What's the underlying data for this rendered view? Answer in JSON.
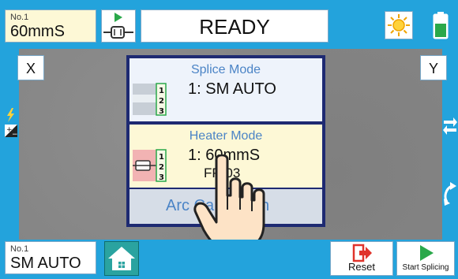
{
  "top": {
    "heater_program_small": "No.1",
    "heater_program_name": "60mmS",
    "status": "READY"
  },
  "camera": {
    "x_label": "X",
    "y_label": "Y"
  },
  "menu": {
    "splice": {
      "title": "Splice Mode",
      "value": "1: SM AUTO"
    },
    "heater": {
      "title": "Heater Mode",
      "value": "1: 60mmS",
      "sub": "FP-03"
    },
    "arc": {
      "label": "Arc Calibration"
    }
  },
  "bottom": {
    "splice_program_small": "No.1",
    "splice_program_name": "SM AUTO",
    "reset_label": "Reset",
    "start_label": "Start Splicing"
  },
  "colors": {
    "frame_blue": "#23a3dc",
    "dialog_navy": "#1e2a72",
    "accent_green": "#2aa84a",
    "reset_red": "#e0332b"
  }
}
